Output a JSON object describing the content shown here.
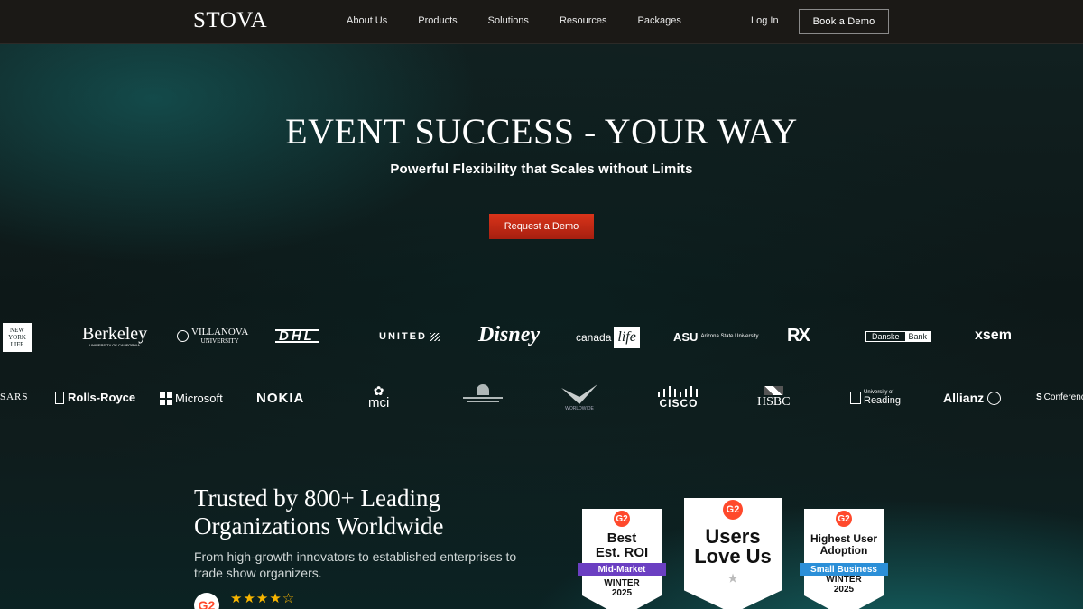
{
  "nav": {
    "logo": "STOVA",
    "links": [
      "About Us",
      "Products",
      "Solutions",
      "Resources",
      "Packages"
    ],
    "login": "Log In",
    "book_demo": "Book a Demo"
  },
  "hero": {
    "title": "EVENT SUCCESS - YOUR WAY",
    "subtitle": "Powerful Flexibility that Scales without Limits",
    "cta": "Request a Demo"
  },
  "logos_row1": {
    "nyl": [
      "NEW",
      "YORK",
      "LIFE"
    ],
    "berkeley": "Berkeley",
    "berkeley_sub": "UNIVERSITY OF CALIFORNIA",
    "villanova": "VILLANOVA",
    "villanova_sub": "UNIVERSITY",
    "dhl": "DHL",
    "united": "UNITED",
    "disney": "Disney",
    "canada_life_a": "canada",
    "canada_life_b": "life",
    "asu": "ASU",
    "asu_sub": "Arizona State University",
    "rx": "RX",
    "danske_a": "Danske",
    "danske_b": "Bank",
    "xsem": "xsem"
  },
  "logos_row2": {
    "sars": "SARS",
    "rolls": "Rolls-Royce",
    "microsoft": "Microsoft",
    "nokia": "NOKIA",
    "mci": "mci",
    "worldwide": "WORLDWIDE",
    "cisco": "CISCO",
    "hsbc": "HSBC",
    "reading_a": "University of",
    "reading_b": "Reading",
    "allianz": "Allianz",
    "conference": "Conference"
  },
  "trusted": {
    "title_line1": "Trusted by 800+ Leading",
    "title_line2": "Organizations Worldwide",
    "desc": "From high-growth innovators to established enterprises to trade show organizers.",
    "g2": "G2",
    "stars": "★★★★☆",
    "rating_out_of_5": 4.5
  },
  "badges": [
    {
      "g2": "G2",
      "line1": "Best",
      "line2": "Est. ROI",
      "ribbon": "Mid-Market",
      "season": "WINTER",
      "year": "2025",
      "ribbon_color": "#6b3fc2"
    },
    {
      "g2": "G2",
      "line1": "Users",
      "line2": "Love Us"
    },
    {
      "g2": "G2",
      "line1": "Highest User",
      "line2": "Adoption",
      "ribbon": "Small Business",
      "season": "WINTER",
      "year": "2025",
      "ribbon_color": "#2b8fd8"
    }
  ],
  "colors": {
    "accent_red": "#c4290f",
    "nav_bg": "#1b1916",
    "g2_red": "#ff492c",
    "star": "#f7b500"
  }
}
